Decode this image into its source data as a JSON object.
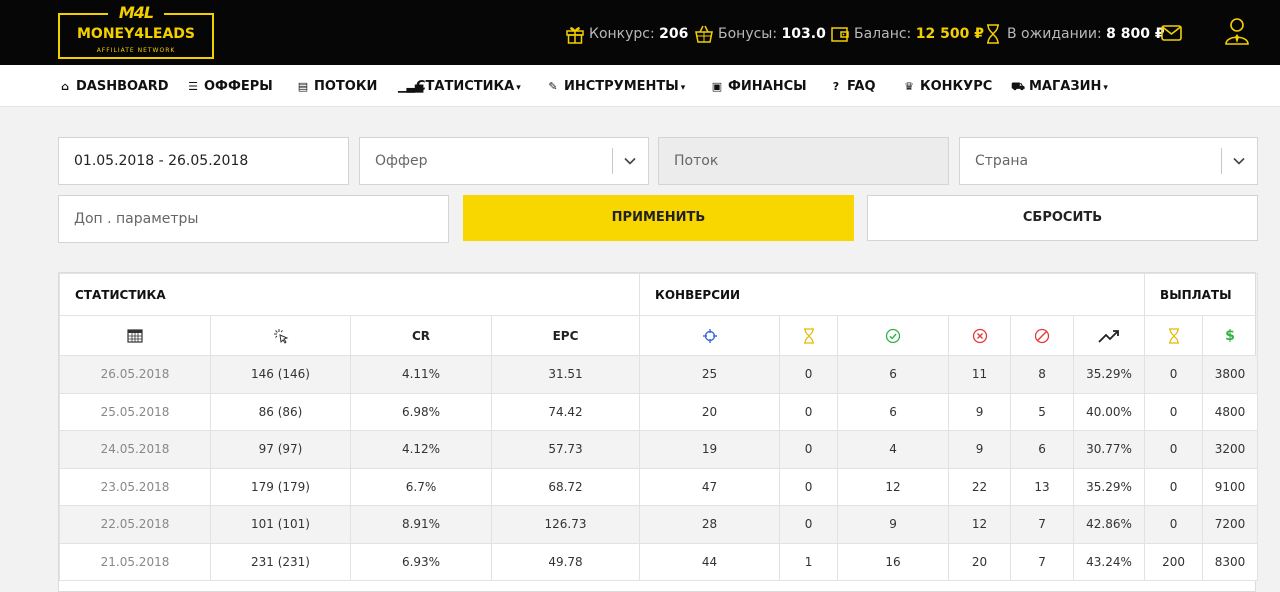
{
  "brand": {
    "mark": "M4L",
    "name": "MONEY4LEADS",
    "tagline": "AFFILIATE NETWORK"
  },
  "header_stats": [
    {
      "icon": "gift-icon",
      "label": "Конкурс:",
      "value": "206",
      "highlight": false
    },
    {
      "icon": "basket-icon",
      "label": "Бонусы:",
      "value": "103.0",
      "highlight": false
    },
    {
      "icon": "wallet-icon",
      "label": "Баланс:",
      "value": "12 500 ₽",
      "highlight": true
    },
    {
      "icon": "hourglass-icon",
      "label": "В ожидании:",
      "value": "8 800 ₽",
      "highlight": false
    }
  ],
  "nav": [
    {
      "icon": "home-icon",
      "label": "DASHBOARD"
    },
    {
      "icon": "list-icon",
      "label": "ОФФЕРЫ"
    },
    {
      "icon": "stream-icon",
      "label": "ПОТОКИ"
    },
    {
      "icon": "bar-chart-icon",
      "label": "СТАТИСТИКА",
      "dropdown": true
    },
    {
      "icon": "wrench-icon",
      "label": "ИНСТРУМЕНТЫ",
      "dropdown": true
    },
    {
      "icon": "money-icon",
      "label": "ФИНАНСЫ"
    },
    {
      "icon": "question-icon",
      "label": "FAQ"
    },
    {
      "icon": "trophy-icon",
      "label": "КОНКУРС"
    },
    {
      "icon": "cart-icon",
      "label": "МАГАЗИН",
      "dropdown": true
    }
  ],
  "filters": {
    "date_range": "01.05.2018 - 26.05.2018",
    "offer_placeholder": "Оффер",
    "stream_placeholder": "Поток",
    "country_placeholder": "Страна",
    "extra_params_placeholder": "Доп . параметры",
    "apply_label": "ПРИМЕНИТЬ",
    "reset_label": "СБРОСИТЬ"
  },
  "table": {
    "groups": [
      "СТАТИСТИКА",
      "КОНВЕРСИИ",
      "ВЫПЛАТЫ"
    ],
    "columns": [
      {
        "icon": "calendar-icon",
        "label": ""
      },
      {
        "icon": "click-icon",
        "label": ""
      },
      {
        "icon": "",
        "label": "CR"
      },
      {
        "icon": "",
        "label": "EPC"
      },
      {
        "icon": "crosshair-icon",
        "label": ""
      },
      {
        "icon": "hourglass-icon",
        "label": ""
      },
      {
        "icon": "check-circle-icon",
        "label": ""
      },
      {
        "icon": "x-circle-icon",
        "label": ""
      },
      {
        "icon": "ban-icon",
        "label": ""
      },
      {
        "icon": "trend-up-icon",
        "label": ""
      },
      {
        "icon": "hourglass-icon",
        "label": ""
      },
      {
        "icon": "dollar-icon",
        "label": "$"
      }
    ],
    "rows": [
      [
        "26.05.2018",
        "146 (146)",
        "4.11%",
        "31.51",
        "25",
        "0",
        "6",
        "11",
        "8",
        "35.29%",
        "0",
        "3800"
      ],
      [
        "25.05.2018",
        "86 (86)",
        "6.98%",
        "74.42",
        "20",
        "0",
        "6",
        "9",
        "5",
        "40.00%",
        "0",
        "4800"
      ],
      [
        "24.05.2018",
        "97 (97)",
        "4.12%",
        "57.73",
        "19",
        "0",
        "4",
        "9",
        "6",
        "30.77%",
        "0",
        "3200"
      ],
      [
        "23.05.2018",
        "179 (179)",
        "6.7%",
        "68.72",
        "47",
        "0",
        "12",
        "22",
        "13",
        "35.29%",
        "0",
        "9100"
      ],
      [
        "22.05.2018",
        "101 (101)",
        "8.91%",
        "126.73",
        "28",
        "0",
        "9",
        "12",
        "7",
        "42.86%",
        "0",
        "7200"
      ],
      [
        "21.05.2018",
        "231 (231)",
        "6.93%",
        "49.78",
        "44",
        "1",
        "16",
        "20",
        "7",
        "43.24%",
        "200",
        "8300"
      ]
    ]
  },
  "colors": {
    "accent": "#f8d600",
    "topbar": "#060606",
    "blue": "#3a6fd8",
    "green": "#2fb344",
    "red": "#e23b3b"
  }
}
